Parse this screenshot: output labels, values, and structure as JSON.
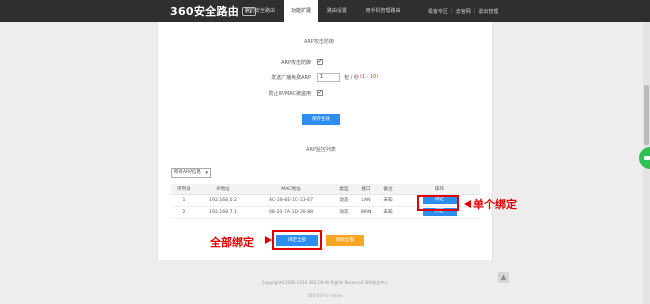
{
  "header": {
    "logo_text": "360安全路由",
    "logo_badge": "P1",
    "tabs": [
      {
        "label": "我的安全路由"
      },
      {
        "label": "功能扩展"
      },
      {
        "label": "路由设置"
      },
      {
        "label": "用手机管理路由"
      }
    ],
    "active_tab_index": 1,
    "links": [
      "极客专区",
      "去官网",
      "退出管理"
    ]
  },
  "arp_protection": {
    "title": "ARP攻击防御",
    "rows": [
      {
        "label": "ARP攻击防御",
        "checked": true
      },
      {
        "label": "发送广播免费ARP",
        "value": "1",
        "unit": "包 / 秒",
        "range": "(1 - 10)"
      },
      {
        "label": "防止IP/MAC被盗用",
        "checked": true
      }
    ],
    "save_label": "保存生效"
  },
  "arp_list": {
    "title": "ARP监控列表",
    "filter_selected": "所有ARP信息",
    "columns": [
      "序列号",
      "IP地址",
      "MAC地址",
      "类型",
      "接口",
      "备注",
      "操作"
    ],
    "rows": [
      {
        "seq": "1",
        "ip": "192.168.0.2",
        "mac": "AC-28-6E-1C-13-67",
        "type": "动态",
        "iface": "LAN",
        "note": "未知",
        "action": "绑定"
      },
      {
        "seq": "2",
        "ip": "192.168.7.1",
        "mac": "08-10-7A-1D-30-88",
        "type": "动态",
        "iface": "WAN",
        "note": "未知",
        "action": "绑定"
      }
    ],
    "bind_all_label": "绑定全部",
    "unbind_all_label": "解除全部"
  },
  "annotations": {
    "single_bind": "单个绑定",
    "all_bind": "全部绑定",
    "color": "#e30000"
  },
  "footer": {
    "copyright": "Copyright©2005-2016 360.CN All Rights Reserved 360安全中心",
    "os": "360 OS For Home"
  },
  "icons": {
    "checkbox_checked": "check-icon",
    "select_chevron": "chevron-down-icon",
    "scroll_top": "arrow-up-icon"
  },
  "colors": {
    "topbar": "#2f2f2f",
    "primary_button": "#2e8ef0",
    "secondary_button": "#f6a623",
    "range_text": "#e53935"
  }
}
